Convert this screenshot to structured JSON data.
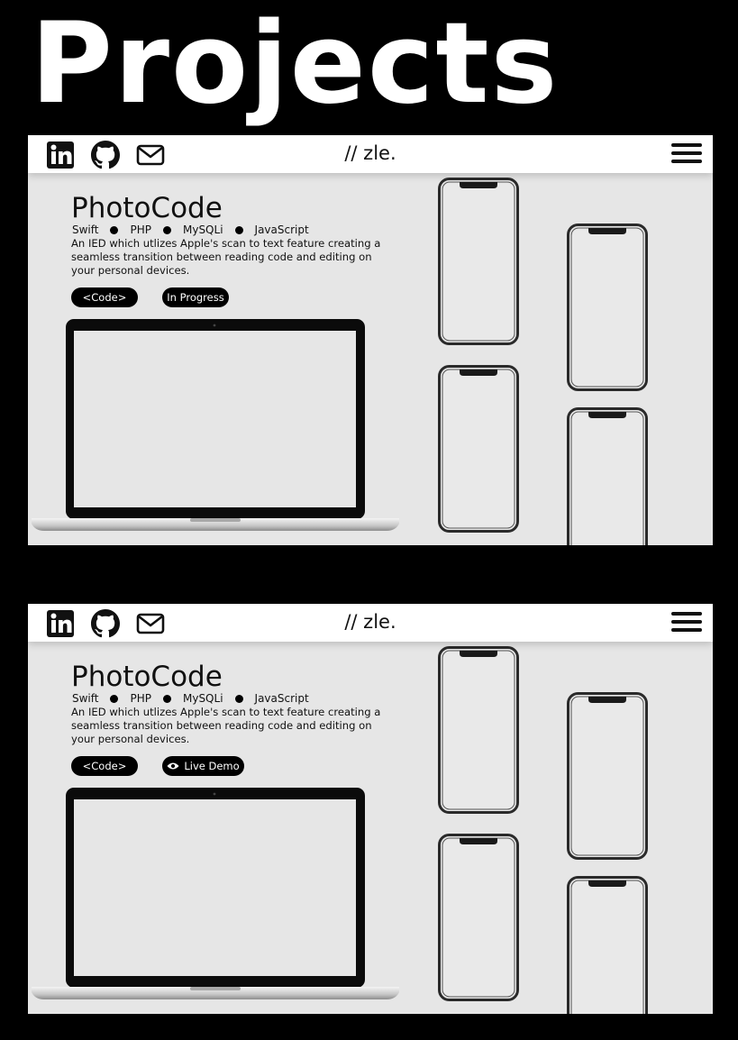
{
  "page": {
    "title": "Projects"
  },
  "navbar": {
    "brand": "// zle."
  },
  "cards": [
    {
      "title": "PhotoCode",
      "tech": [
        "Swift",
        "PHP",
        "MySQLi",
        "JavaScript"
      ],
      "description": "An IED which utlizes Apple's scan to text feature creating a seamless transition between reading code and editing on your personal devices.",
      "code_label": "<Code>",
      "status_label": "In Progress"
    },
    {
      "title": "PhotoCode",
      "tech": [
        "Swift",
        "PHP",
        "MySQLi",
        "JavaScript"
      ],
      "description": "An IED which utlizes Apple's scan to text feature creating a seamless transition between reading code and editing on your personal devices.",
      "code_label": "<Code>",
      "demo_label": "Live Demo"
    }
  ],
  "icons": {
    "social": [
      "linkedin-icon",
      "github-icon",
      "mail-icon"
    ],
    "menu": "hamburger-menu-icon",
    "demo": "eye-icon"
  }
}
